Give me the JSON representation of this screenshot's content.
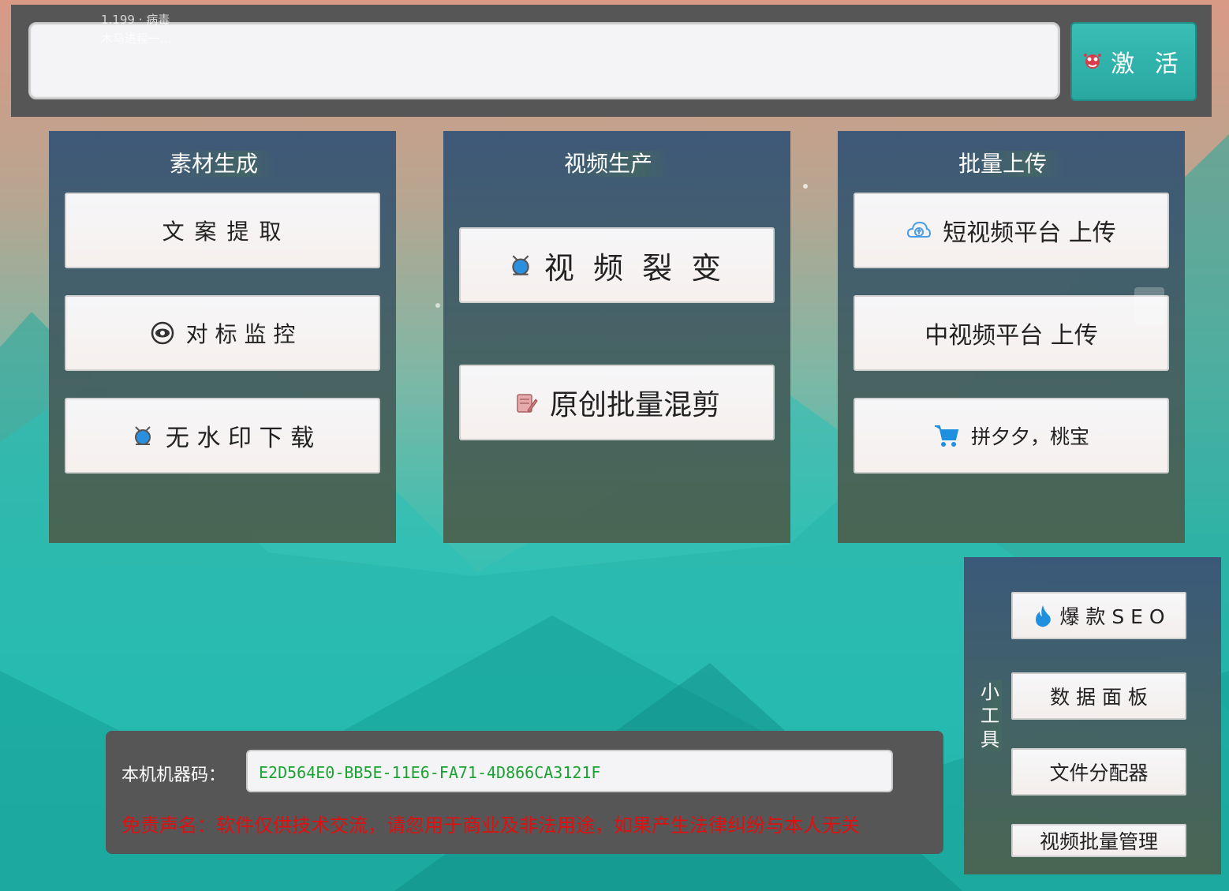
{
  "header": {
    "ghost_line1": "1.199 · 病毒",
    "ghost_line2": "木马进程一...",
    "activation_input": "",
    "activate_label": "激 活",
    "activate_icon": "red-badge-icon"
  },
  "panels": {
    "material": {
      "title": "素材生成",
      "buttons": [
        {
          "label": "文 案 提 取"
        },
        {
          "label": "对 标 监 控",
          "icon": "eye-icon"
        },
        {
          "label": "无 水 印 下 载",
          "icon": "satellite-icon"
        }
      ]
    },
    "video": {
      "title": "视频生产",
      "buttons": [
        {
          "label": "视 频 裂 变",
          "icon": "satellite-icon"
        },
        {
          "label": "原创批量混剪",
          "icon": "edit-icon"
        }
      ]
    },
    "upload": {
      "title": "批量上传",
      "buttons": [
        {
          "label": "短视频平台 上传",
          "icon": "upload-cloud-icon"
        },
        {
          "label": "中视频平台 上传"
        },
        {
          "label": "拼夕夕，桃宝",
          "icon": "cart-icon"
        }
      ]
    }
  },
  "tools": {
    "title": "小工具",
    "title_chars": [
      "小",
      "工",
      "具"
    ],
    "buttons": [
      {
        "label": "爆 款 S E O",
        "icon": "flame-icon"
      },
      {
        "label": "数 据 面 板"
      },
      {
        "label": "文件分配器"
      },
      {
        "label": "视频批量管理"
      }
    ]
  },
  "machine": {
    "label": "本机机器码：",
    "code": "E2D564E0-BB5E-11E6-FA71-4D866CA3121F",
    "disclaimer": "免责声名：软件仅供技术交流，请忽用于商业及非法用途，如果产生法律纠纷与本人无关"
  },
  "colors": {
    "accent": "#2fb3ab",
    "panel": "#3f5f73",
    "bar": "#565656",
    "code_text": "#1aa232",
    "disclaimer": "#e01010"
  }
}
